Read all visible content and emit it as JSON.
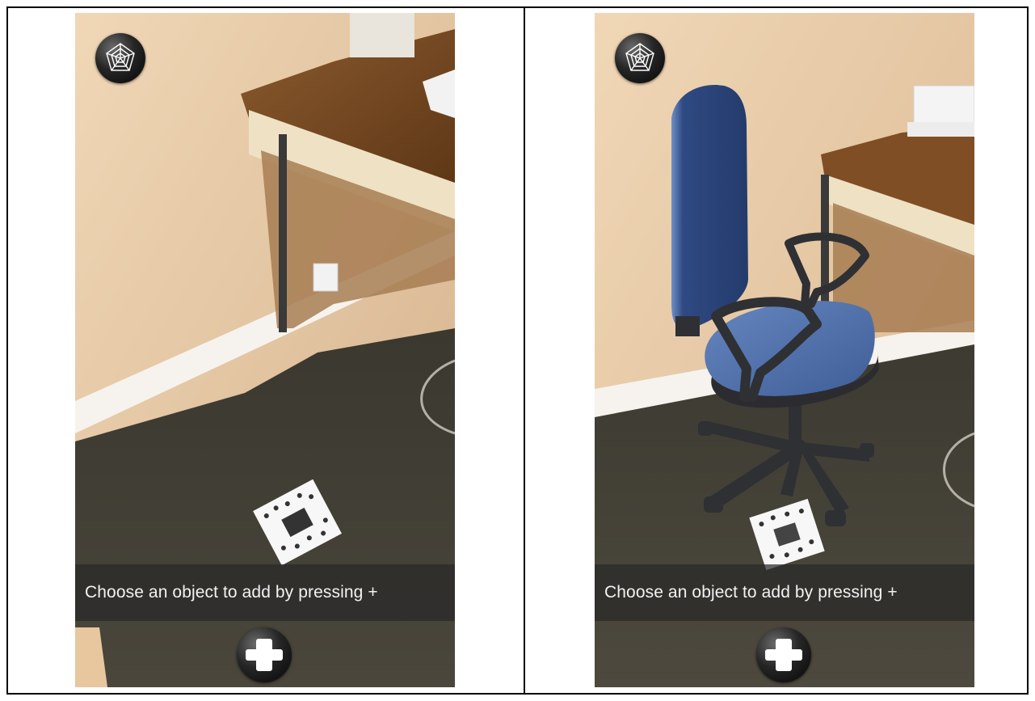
{
  "panels": [
    {
      "id": "left",
      "caption": "Choose an object to add by pressing +",
      "icons": {
        "top_left": "spider-web-icon",
        "bottom": "plus-icon"
      },
      "scene": "room-without-chair"
    },
    {
      "id": "right",
      "caption": "Choose an object to add by pressing +",
      "icons": {
        "top_left": "spider-web-icon",
        "bottom": "plus-icon"
      },
      "scene": "room-with-ar-chair"
    }
  ],
  "colors": {
    "wall": "#e7c8a3",
    "floor": "#3f3b33",
    "desk": "#7a4a22",
    "chair_seat": "#4f6fa8",
    "chair_back": "#304a82",
    "caption_bg": "#2b2b2b"
  }
}
